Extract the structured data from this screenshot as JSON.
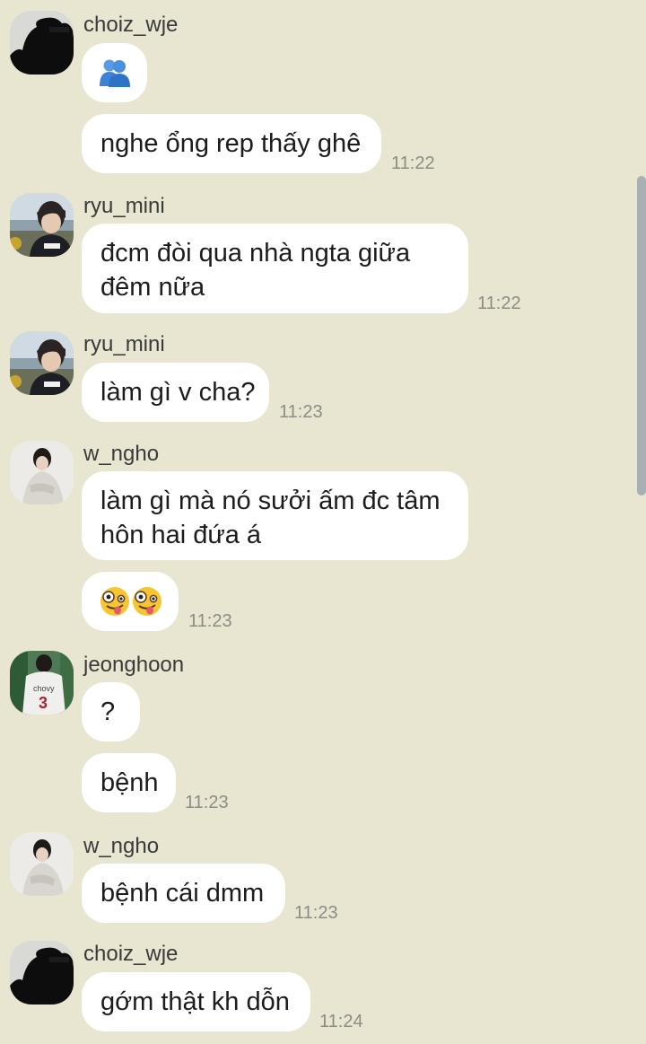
{
  "chat": {
    "messages": [
      {
        "sender": "choiz_wje",
        "bubble_1": "👥",
        "text": "nghe ổng rep thấy ghê",
        "time": "11:22"
      },
      {
        "sender": "ryu_mini",
        "line_1": "đcm đòi qua nhà ngta giữa",
        "line_2": "đêm nữa",
        "time": "11:22"
      },
      {
        "sender": "ryu_mini",
        "text": "làm gì v cha?",
        "time": "11:23"
      },
      {
        "sender": "w_ngho",
        "line_1": "làm gì mà nó sưởi ấm đc tâm",
        "line_2": "hôn hai đứa á",
        "emoji": "🤪🤪",
        "time": "11:23"
      },
      {
        "sender": "jeonghoon",
        "bubble_1": "?",
        "text": "bệnh",
        "time": "11:23",
        "jersey_text": "chovy",
        "jersey_number": "3"
      },
      {
        "sender": "w_ngho",
        "text": "bệnh cái dmm",
        "time": "11:23"
      },
      {
        "sender": "choiz_wje",
        "text": "gớm thật kh dỗn",
        "time": "11:24"
      }
    ]
  },
  "colors": {
    "background": "#e8e6d1",
    "bubble": "#ffffff",
    "timestamp": "#8c8c84",
    "scrollbar": "#a9b0b3",
    "people_emoji": "#3d82d6"
  },
  "icons": {
    "people_emoji": "busts-in-silhouette-icon",
    "zany_emoji": "zany-face-icon"
  }
}
